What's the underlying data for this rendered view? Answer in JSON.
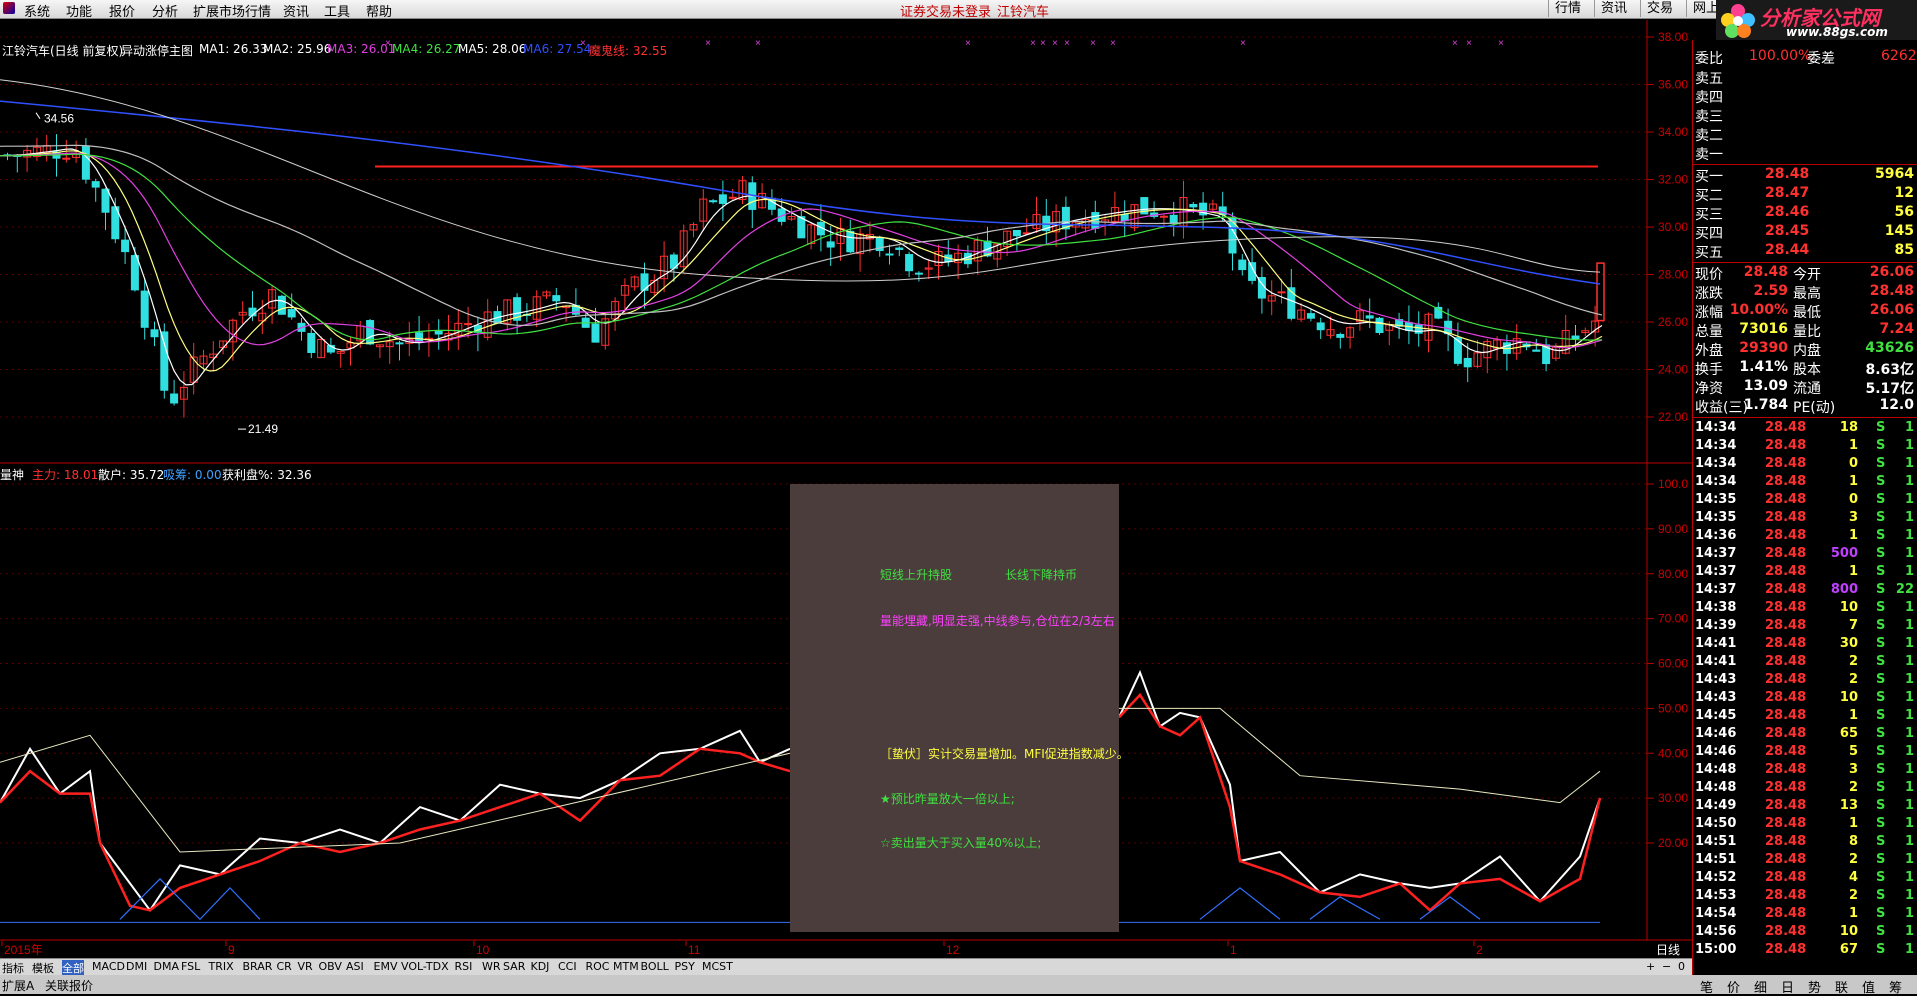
{
  "menu": [
    "系统",
    "功能",
    "报价",
    "分析",
    "扩展市场行情",
    "资讯",
    "工具",
    "帮助"
  ],
  "menu_center": [
    "证券交易未登录",
    "江铃汽车"
  ],
  "menu_right": [
    "行情",
    "资讯",
    "交易",
    "网上"
  ],
  "logo_text": "分析家公式网",
  "logo_url": "www.88gs.com",
  "main_chart": {
    "title": "江铃汽车(日线 前复权)",
    "indicator": "异动涨停主图",
    "ma": [
      {
        "label": "MA1: 26.33",
        "color": "#ffffff"
      },
      {
        "label": "MA2: 25.96",
        "color": "#ffffff"
      },
      {
        "label": "MA3: 26.01",
        "color": "#e040e0"
      },
      {
        "label": "MA4: 26.27",
        "color": "#40e040"
      },
      {
        "label": "MA5: 28.06",
        "color": "#ffffff"
      },
      {
        "label": "MA6: 27.54",
        "color": "#3050ff"
      },
      {
        "label": "魔鬼线: 32.55",
        "color": "#ff3030"
      }
    ],
    "high_marker": "34.56",
    "low_marker": "21.49",
    "y_ticks": [
      "38.00",
      "36.00",
      "34.00",
      "32.00",
      "30.00",
      "28.00",
      "26.00",
      "24.00",
      "22.00"
    ]
  },
  "sub_chart": {
    "title": "量神",
    "items": [
      {
        "label": "主力: 18.01",
        "color": "#ff3030"
      },
      {
        "label": "散户: 35.72",
        "color": "#ffffff"
      },
      {
        "label": "吸筹: 0.00",
        "color": "#40a0ff"
      },
      {
        "label": "获利盘%: 32.36",
        "color": "#ffffff"
      }
    ],
    "y_ticks": [
      "100.0",
      "90.00",
      "80.00",
      "70.00",
      "60.00",
      "50.00",
      "40.00",
      "30.00",
      "20.00"
    ]
  },
  "overlay": {
    "line1a": "短线上升持股",
    "line1b": "长线下降持币",
    "line2": "量能埋藏,明显走强,中线参与,仓位在2/3左右",
    "line3": "［蛰伏］实计交易量增加。MFI促进指数减少。",
    "line4": "★预比昨量放大一倍以上;",
    "line5": "☆卖出量大于买入量40%以上;"
  },
  "x_axis": {
    "labels": [
      "2015年",
      "9",
      "10",
      "11",
      "12",
      "1",
      "2"
    ],
    "period": "日线"
  },
  "indicator_tabs": [
    "指标",
    "模板",
    "全部",
    "MACD",
    "DMI",
    "DMA",
    "FSL",
    "TRIX",
    "BRAR",
    "CR",
    "VR",
    "OBV",
    "ASI",
    "EMV",
    "VOL-TDX",
    "RSI",
    "WR",
    "SAR",
    "KDJ",
    "CCI",
    "ROC",
    "MTM",
    "BOLL",
    "PSY",
    "MCST"
  ],
  "status": [
    "扩展A",
    "关联报价"
  ],
  "quote": {
    "wei": {
      "l1": "委比",
      "v1": "100.00%",
      "l2": "委差",
      "v2": "6262"
    },
    "sell": [
      {
        "label": "卖五",
        "price": "",
        "vol": ""
      },
      {
        "label": "卖四",
        "price": "",
        "vol": ""
      },
      {
        "label": "卖三",
        "price": "",
        "vol": ""
      },
      {
        "label": "卖二",
        "price": "",
        "vol": ""
      },
      {
        "label": "卖一",
        "price": "",
        "vol": ""
      }
    ],
    "buy": [
      {
        "label": "买一",
        "price": "28.48",
        "vol": "5964"
      },
      {
        "label": "买二",
        "price": "28.47",
        "vol": "12"
      },
      {
        "label": "买三",
        "price": "28.46",
        "vol": "56"
      },
      {
        "label": "买四",
        "price": "28.45",
        "vol": "145"
      },
      {
        "label": "买五",
        "price": "28.44",
        "vol": "85"
      }
    ],
    "stats": [
      {
        "l1": "现价",
        "v1": "28.48",
        "c1": "#ff3030",
        "l2": "今开",
        "v2": "26.06",
        "c2": "#ff3030"
      },
      {
        "l1": "涨跌",
        "v1": "2.59",
        "c1": "#ff3030",
        "l2": "最高",
        "v2": "28.48",
        "c2": "#ff3030"
      },
      {
        "l1": "涨幅",
        "v1": "10.00%",
        "c1": "#ff3030",
        "l2": "最低",
        "v2": "26.06",
        "c2": "#ff3030"
      },
      {
        "l1": "总量",
        "v1": "73016",
        "c1": "#ffff40",
        "l2": "量比",
        "v2": "7.24",
        "c2": "#ff3030"
      },
      {
        "l1": "外盘",
        "v1": "29390",
        "c1": "#ff3030",
        "l2": "内盘",
        "v2": "43626",
        "c2": "#40e040"
      },
      {
        "l1": "换手",
        "v1": "1.41%",
        "c1": "#ffffff",
        "l2": "股本",
        "v2": "8.63亿",
        "c2": "#ffffff"
      },
      {
        "l1": "净资",
        "v1": "13.09",
        "c1": "#ffffff",
        "l2": "流通",
        "v2": "5.17亿",
        "c2": "#ffffff"
      },
      {
        "l1": "收益(三)",
        "v1": "1.784",
        "c1": "#ffffff",
        "l2": "PE(动)",
        "v2": "12.0",
        "c2": "#ffffff"
      }
    ],
    "ticks": [
      {
        "t": "14:34",
        "p": "28.48",
        "v": "18",
        "s": "S",
        "n": "1"
      },
      {
        "t": "14:34",
        "p": "28.48",
        "v": "1",
        "s": "S",
        "n": "1"
      },
      {
        "t": "14:34",
        "p": "28.48",
        "v": "0",
        "s": "S",
        "n": "1"
      },
      {
        "t": "14:34",
        "p": "28.48",
        "v": "1",
        "s": "S",
        "n": "1"
      },
      {
        "t": "14:35",
        "p": "28.48",
        "v": "0",
        "s": "S",
        "n": "1"
      },
      {
        "t": "14:35",
        "p": "28.48",
        "v": "3",
        "s": "S",
        "n": "1"
      },
      {
        "t": "14:36",
        "p": "28.48",
        "v": "1",
        "s": "S",
        "n": "1"
      },
      {
        "t": "14:37",
        "p": "28.48",
        "v": "500",
        "s": "S",
        "n": "1"
      },
      {
        "t": "14:37",
        "p": "28.48",
        "v": "1",
        "s": "S",
        "n": "1"
      },
      {
        "t": "14:37",
        "p": "28.48",
        "v": "800",
        "s": "S",
        "n": "22"
      },
      {
        "t": "14:38",
        "p": "28.48",
        "v": "10",
        "s": "S",
        "n": "1"
      },
      {
        "t": "14:39",
        "p": "28.48",
        "v": "7",
        "s": "S",
        "n": "1"
      },
      {
        "t": "14:41",
        "p": "28.48",
        "v": "30",
        "s": "S",
        "n": "1"
      },
      {
        "t": "14:41",
        "p": "28.48",
        "v": "2",
        "s": "S",
        "n": "1"
      },
      {
        "t": "14:43",
        "p": "28.48",
        "v": "2",
        "s": "S",
        "n": "1"
      },
      {
        "t": "14:43",
        "p": "28.48",
        "v": "10",
        "s": "S",
        "n": "1"
      },
      {
        "t": "14:45",
        "p": "28.48",
        "v": "1",
        "s": "S",
        "n": "1"
      },
      {
        "t": "14:46",
        "p": "28.48",
        "v": "65",
        "s": "S",
        "n": "1"
      },
      {
        "t": "14:46",
        "p": "28.48",
        "v": "5",
        "s": "S",
        "n": "1"
      },
      {
        "t": "14:48",
        "p": "28.48",
        "v": "3",
        "s": "S",
        "n": "1"
      },
      {
        "t": "14:48",
        "p": "28.48",
        "v": "2",
        "s": "S",
        "n": "1"
      },
      {
        "t": "14:49",
        "p": "28.48",
        "v": "13",
        "s": "S",
        "n": "1"
      },
      {
        "t": "14:50",
        "p": "28.48",
        "v": "1",
        "s": "S",
        "n": "1"
      },
      {
        "t": "14:51",
        "p": "28.48",
        "v": "8",
        "s": "S",
        "n": "1"
      },
      {
        "t": "14:51",
        "p": "28.48",
        "v": "2",
        "s": "S",
        "n": "1"
      },
      {
        "t": "14:52",
        "p": "28.48",
        "v": "4",
        "s": "S",
        "n": "1"
      },
      {
        "t": "14:53",
        "p": "28.48",
        "v": "2",
        "s": "S",
        "n": "1"
      },
      {
        "t": "14:54",
        "p": "28.48",
        "v": "1",
        "s": "S",
        "n": "1"
      },
      {
        "t": "14:56",
        "p": "28.48",
        "v": "10",
        "s": "S",
        "n": "1"
      },
      {
        "t": "15:00",
        "p": "28.48",
        "v": "67",
        "s": "S",
        "n": "1"
      }
    ],
    "bottom_tabs": [
      "笔",
      "价",
      "细",
      "日",
      "势",
      "联",
      "值",
      "筹"
    ]
  }
}
